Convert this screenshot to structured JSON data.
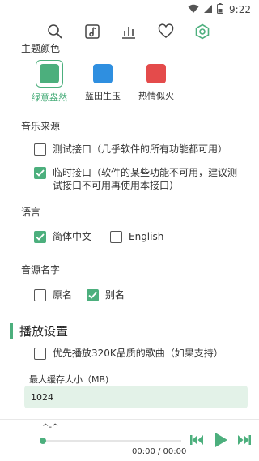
{
  "status": {
    "time": "9:22",
    "icons": [
      "wifi-icon",
      "signal-icon",
      "battery-icon"
    ]
  },
  "toolbar": {
    "icons": [
      "search-icon",
      "music-note-icon",
      "bar-chart-icon",
      "heart-icon",
      "settings-icon"
    ]
  },
  "theme": {
    "title": "主题颜色",
    "options": [
      {
        "label": "绿意盎然",
        "color": "#4caf7d",
        "selected": true
      },
      {
        "label": "蓝田生玉",
        "color": "#2f8fe0",
        "selected": false
      },
      {
        "label": "热情似火",
        "color": "#e44b4b",
        "selected": false
      }
    ]
  },
  "music_source": {
    "title": "音乐来源",
    "options": [
      {
        "label": "测试接口（几乎软件的所有功能都可用）",
        "checked": false
      },
      {
        "label": "临时接口（软件的某些功能不可用，建议测试接口不可用再使用本接口）",
        "checked": true
      }
    ]
  },
  "language": {
    "title": "语言",
    "options": [
      {
        "label": "简体中文",
        "checked": true
      },
      {
        "label": "English",
        "checked": false
      }
    ]
  },
  "source_name": {
    "title": "音源名字",
    "options": [
      {
        "label": "原名",
        "checked": false
      },
      {
        "label": "别名",
        "checked": true
      }
    ]
  },
  "playback": {
    "title": "播放设置",
    "prefer_320k": {
      "label": "优先播放320K品质的歌曲（如果支持）",
      "checked": false
    },
    "max_cache": {
      "label": "最大缓存大小（MB)",
      "value": "1024"
    }
  },
  "player": {
    "track": "^-^",
    "time": "00:00 / 00:00",
    "progress": 0,
    "accent": "#4caf7d"
  }
}
